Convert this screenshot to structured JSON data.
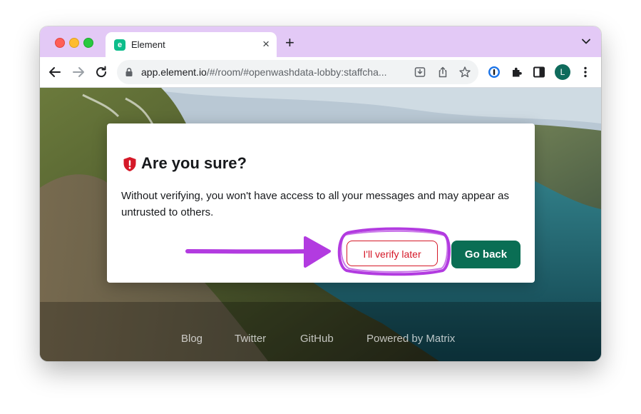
{
  "browser": {
    "tab_title": "Element",
    "tab_close": "×",
    "new_tab": "+",
    "url_host": "app.element.io",
    "url_path": "/#/room/#openwashdata-lobby:staffcha...",
    "profile_initial": "L"
  },
  "dialog": {
    "title": "Are you sure?",
    "body": "Without verifying, you won't have access to all your messages and may appear as untrusted to others.",
    "verify_later_label": "I'll verify later",
    "go_back_label": "Go back"
  },
  "footer": {
    "links": [
      "Blog",
      "Twitter",
      "GitHub",
      "Powered by Matrix"
    ]
  },
  "colors": {
    "tabbar": "#e3c9f6",
    "danger": "#d51928",
    "primary": "#0a6e54",
    "annotation": "#b23be0"
  },
  "icons": [
    "back-arrow-icon",
    "forward-arrow-icon",
    "reload-icon",
    "lock-icon",
    "install-icon",
    "share-icon",
    "star-icon",
    "password-manager-icon",
    "extensions-icon",
    "sidepanel-icon",
    "kebab-menu-icon",
    "shield-warning-icon",
    "annotation-arrow",
    "annotation-circle"
  ]
}
